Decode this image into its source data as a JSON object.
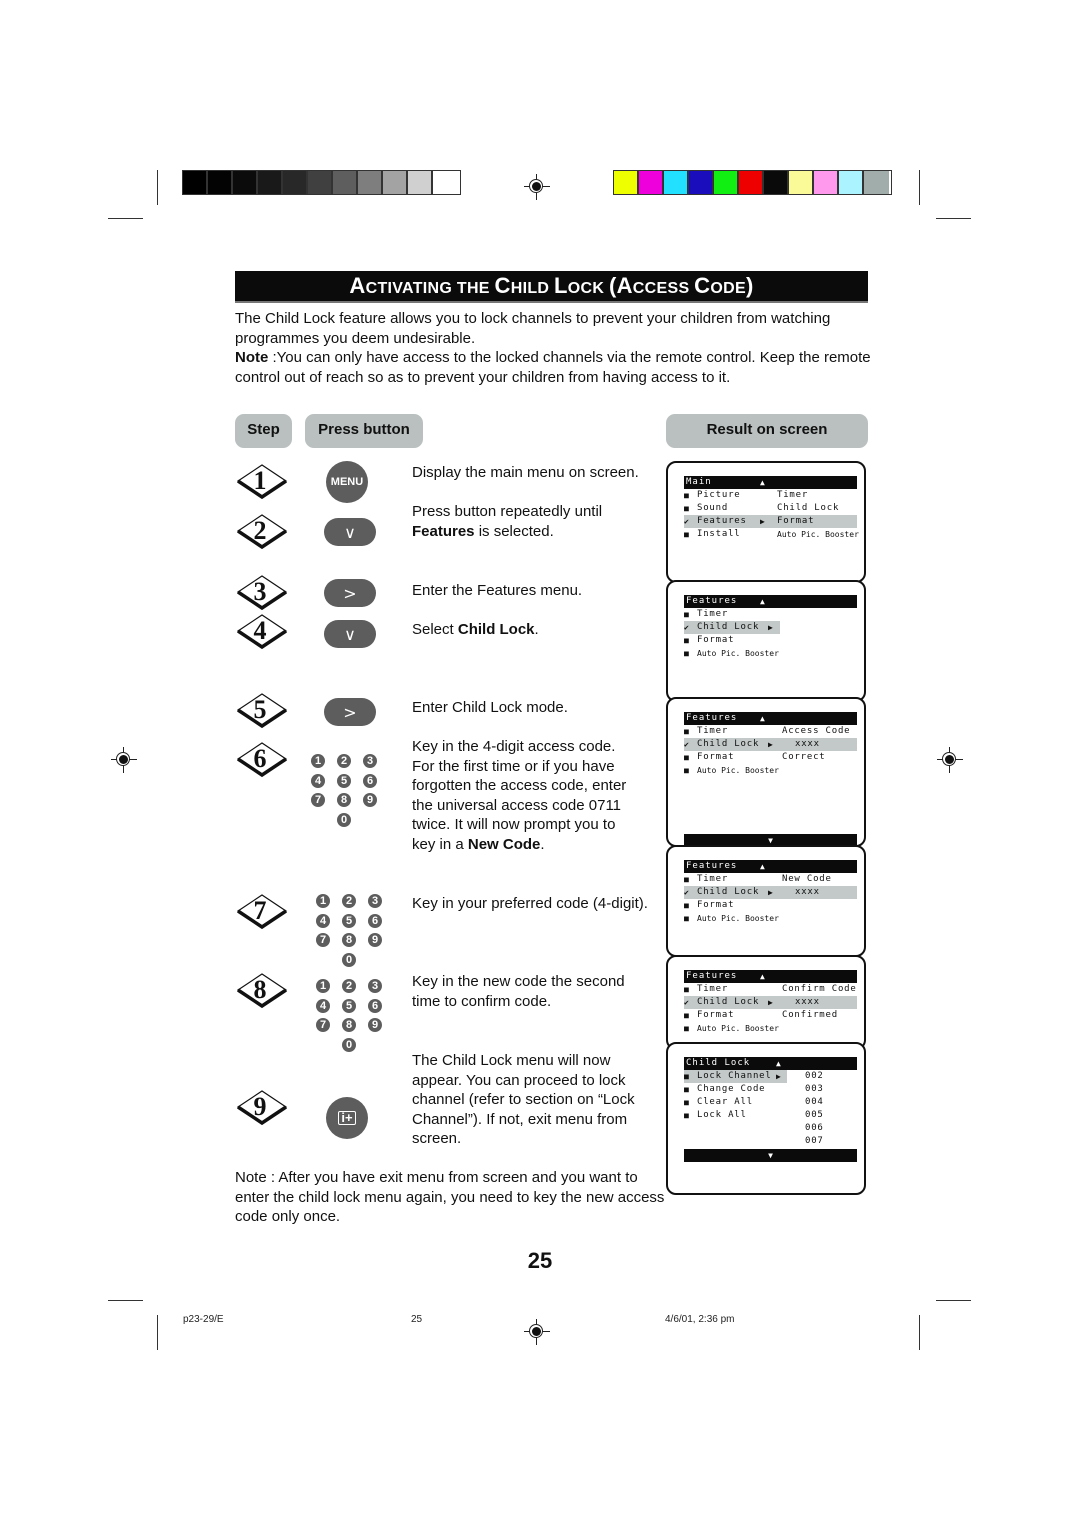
{
  "print_marks": {
    "grayscale_swatches": [
      "#000000",
      "#030303",
      "#0b0b0b",
      "#191919",
      "#282828",
      "#404040",
      "#5e5e5e",
      "#7e7e7e",
      "#a3a3a3",
      "#d0d0d0",
      "#ffffff"
    ],
    "color_swatches": [
      "#eeff00",
      "#ee00dd",
      "#22e0ff",
      "#1a0dbb",
      "#11ee11",
      "#ee0000",
      "#0a0a0a",
      "#fafa99",
      "#ff99ee",
      "#aaf3ff",
      "#a0adab"
    ]
  },
  "header": {
    "title_parts": [
      {
        "big": "A",
        "small": "CTIVATING THE "
      },
      {
        "big": "C",
        "small": "HILD "
      },
      {
        "big": "L",
        "small": "OCK "
      },
      {
        "big": "(A",
        "small": "CCESS "
      },
      {
        "big": "C",
        "small": "ODE"
      },
      {
        "big": ")",
        "small": ""
      }
    ]
  },
  "intro": {
    "text": "The Child Lock feature allows you to lock channels to prevent your children from watching programmes you deem undesirable.",
    "note_label": "Note",
    "note_text": " :You can only have access to the locked channels via the remote control. Keep the remote control out of reach so as to prevent your children from having access to it."
  },
  "columns": {
    "step": "Step",
    "press_button": "Press button",
    "result": "Result on screen"
  },
  "steps": [
    {
      "num": "1",
      "button": "MENU",
      "desc": "Display the main menu on screen."
    },
    {
      "num": "2",
      "button": "down-arrow",
      "desc_pre": "Press button repeatedly until ",
      "desc_bold": "Features",
      "desc_post": " is selected."
    },
    {
      "num": "3",
      "button": "right-arrow",
      "desc": "Enter the Features menu."
    },
    {
      "num": "4",
      "button": "down-arrow",
      "desc_pre": "Select ",
      "desc_bold": "Child Lock",
      "desc_post": "."
    },
    {
      "num": "5",
      "button": "right-arrow",
      "desc": "Enter Child Lock mode."
    },
    {
      "num": "6",
      "button": "keypad",
      "desc_pre": "Key in the 4-digit access code. For the first time or if you have forgotten the access code, enter the universal access code 0711 twice. It will now prompt you to key in a ",
      "desc_bold": "New Code",
      "desc_post": "."
    },
    {
      "num": "7",
      "button": "keypad",
      "desc": "Key in your preferred code (4-digit)."
    },
    {
      "num": "8",
      "button": "keypad",
      "desc": "Key in the new code the second time to confirm code."
    },
    {
      "num": "9",
      "button": "info-exit",
      "desc": "The Child Lock menu will now appear. You can proceed to lock channel (refer to section on “Lock Channel”). If not, exit menu from screen."
    }
  ],
  "glyphs": {
    "down": "∨",
    "right": ">",
    "menu": "MENU",
    "info": "i+",
    "up_tri": "▲",
    "down_tri": "▼",
    "right_tri": "▶",
    "check": "✔",
    "square": "■"
  },
  "keypad_keys": [
    "1",
    "2",
    "3",
    "4",
    "5",
    "6",
    "7",
    "8",
    "9",
    "0"
  ],
  "screens": [
    {
      "title": "Main",
      "rows": [
        {
          "bullet": "square",
          "label": "Picture",
          "value": "Timer"
        },
        {
          "bullet": "square",
          "label": "Sound",
          "value": "Child Lock"
        },
        {
          "bullet": "check",
          "label": "Features",
          "value": "Format",
          "selected": true
        },
        {
          "bullet": "square",
          "label": "Install",
          "value": "Auto Pic. Booster"
        }
      ]
    },
    {
      "title": "Features",
      "rows": [
        {
          "bullet": "square",
          "label": "Timer",
          "value": ""
        },
        {
          "bullet": "check",
          "label": "Child Lock",
          "value": "",
          "selected": true
        },
        {
          "bullet": "square",
          "label": "Format",
          "value": ""
        },
        {
          "bullet": "square",
          "label": "Auto Pic. Booster",
          "value": ""
        }
      ]
    },
    {
      "title": "Features",
      "rows": [
        {
          "bullet": "square",
          "label": "Timer",
          "value": "Access Code"
        },
        {
          "bullet": "check",
          "label": "Child Lock",
          "value": "xxxx",
          "selected": true
        },
        {
          "bullet": "square",
          "label": "Format",
          "value": "Correct"
        },
        {
          "bullet": "square",
          "label": "Auto Pic. Booster",
          "value": ""
        }
      ]
    },
    {
      "title": "Features",
      "rows": [
        {
          "bullet": "square",
          "label": "Timer",
          "value": "New Code"
        },
        {
          "bullet": "check",
          "label": "Child Lock",
          "value": "xxxx",
          "selected": true
        },
        {
          "bullet": "square",
          "label": "Format",
          "value": ""
        },
        {
          "bullet": "square",
          "label": "Auto Pic. Booster",
          "value": ""
        }
      ]
    },
    {
      "title": "Features",
      "rows": [
        {
          "bullet": "square",
          "label": "Timer",
          "value": "Confirm Code"
        },
        {
          "bullet": "check",
          "label": "Child Lock",
          "value": "xxxx",
          "selected": true
        },
        {
          "bullet": "square",
          "label": "Format",
          "value": "Confirmed"
        },
        {
          "bullet": "square",
          "label": "Auto Pic. Booster",
          "value": ""
        }
      ]
    },
    {
      "title": "Child Lock",
      "rows": [
        {
          "bullet": "square",
          "label": "Lock Channel",
          "value": "002",
          "selected": true
        },
        {
          "bullet": "square",
          "label": "Change Code",
          "value": "003"
        },
        {
          "bullet": "square",
          "label": "Clear All",
          "value": "004"
        },
        {
          "bullet": "square",
          "label": "Lock All",
          "value": "005"
        },
        {
          "bullet": "",
          "label": "",
          "value": "006"
        },
        {
          "bullet": "",
          "label": "",
          "value": "007"
        }
      ]
    }
  ],
  "note2": "Note :  After you have exit menu from screen and you want to enter the child lock menu again, you need to key the new access code only once.",
  "page_number": "25",
  "footer": {
    "file": "p23-29/E",
    "page": "25",
    "date": "4/6/01, 2:36 pm"
  }
}
